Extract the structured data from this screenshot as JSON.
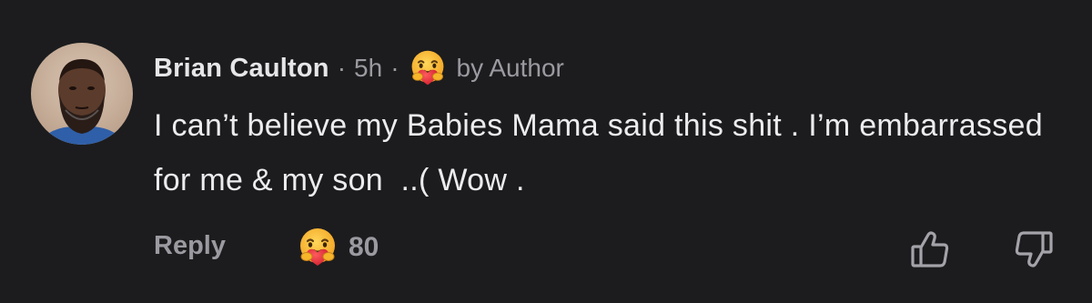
{
  "comment": {
    "author": {
      "name": "Brian Caulton",
      "avatar": "avatar-icon"
    },
    "separator": "·",
    "time": "5h",
    "author_badge": {
      "icon": "care-reaction-icon",
      "label": "by Author"
    },
    "text": "I can’t believe my Babies Mama said this shit . I’m embarrassed for me & my son  ..( Wow .",
    "actions": {
      "reply_label": "Reply",
      "reaction_icon": "care-reaction-icon",
      "reaction_count": "80",
      "upvote_icon": "thumbs-up-icon",
      "downvote_icon": "thumbs-down-icon"
    }
  },
  "colors": {
    "background": "#1c1c1e",
    "primary_text": "#ececee",
    "secondary_text": "#9a9aa0",
    "care_face": "#f6b52a",
    "care_heart": "#e8333d"
  }
}
